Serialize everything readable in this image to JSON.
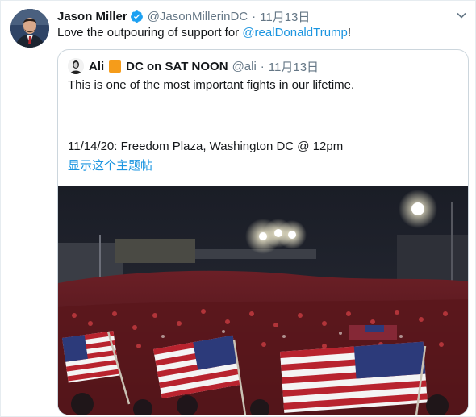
{
  "tweet": {
    "author_name": "Jason Miller",
    "author_handle": "@JasonMillerinDC",
    "separator": "·",
    "date": "11月13日",
    "text_prefix": "Love the outpouring of support for ",
    "mention": "@realDonaldTrump",
    "text_suffix": "!",
    "verified_icon": "verified-badge-icon",
    "more_icon": "chevron-down-icon",
    "colors": {
      "link": "#1b95e0",
      "secondary": "#657786",
      "border": "#ccd6dd"
    }
  },
  "quoted_tweet": {
    "author_name": "Ali",
    "author_name_suffix": "DC on SAT NOON",
    "emoji": "orange-square-emoji",
    "author_handle": "@ali",
    "separator": "·",
    "date": "11月13日",
    "text": "This is one of the most important fights in our lifetime.",
    "event_line": "11/14/20:  Freedom Plaza, Washington DC @ 12pm",
    "show_thread": "显示这个主题帖",
    "media_description_icon": "rally-crowd-video-image"
  }
}
